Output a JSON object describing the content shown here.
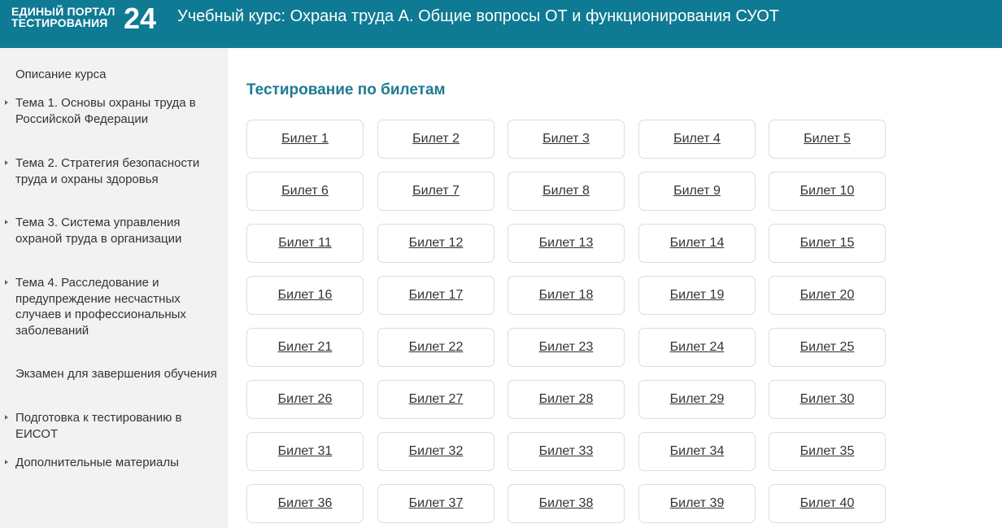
{
  "header": {
    "logo_line1": "ЕДИНЫЙ ПОРТАЛ",
    "logo_line2": "ТЕСТИРОВАНИЯ",
    "logo_number": "24",
    "title": "Учебный курс: Охрана труда А. Общие вопросы ОТ и функционирования СУОТ"
  },
  "sidebar": {
    "items": [
      {
        "label": "Описание курса",
        "arrow": false
      },
      {
        "label": "Тема 1. Основы охраны труда в Российской Федерации",
        "arrow": true
      },
      {
        "label": "Тема 2. Стратегия безопасности труда и охраны здоровья",
        "arrow": true
      },
      {
        "label": "Тема 3. Система управления охраной труда в организации",
        "arrow": true
      },
      {
        "label": "Тема 4. Расследование и предупреждение несчастных случаев и профессиональных заболеваний",
        "arrow": true
      },
      {
        "label": "Экзамен для завершения обучения",
        "arrow": false
      },
      {
        "label": "Подготовка к тестированию в ЕИСОТ",
        "arrow": true
      },
      {
        "label": "Дополнительные материалы",
        "arrow": true
      }
    ]
  },
  "main": {
    "title": "Тестирование по билетам",
    "tickets": [
      "Билет 1",
      "Билет 2",
      "Билет 3",
      "Билет 4",
      "Билет 5",
      "Билет 6",
      "Билет 7",
      "Билет 8",
      "Билет 9",
      "Билет 10",
      "Билет 11",
      "Билет 12",
      "Билет 13",
      "Билет 14",
      "Билет 15",
      "Билет 16",
      "Билет 17",
      "Билет 18",
      "Билет 19",
      "Билет 20",
      "Билет 21",
      "Билет 22",
      "Билет 23",
      "Билет 24",
      "Билет 25",
      "Билет 26",
      "Билет 27",
      "Билет 28",
      "Билет 29",
      "Билет 30",
      "Билет 31",
      "Билет 32",
      "Билет 33",
      "Билет 34",
      "Билет 35",
      "Билет 36",
      "Билет 37",
      "Билет 38",
      "Билет 39",
      "Билет 40"
    ]
  },
  "colors": {
    "header_bg": "#0f7a93",
    "accent": "#1f7a93",
    "sidebar_bg": "#f2f2f2"
  }
}
